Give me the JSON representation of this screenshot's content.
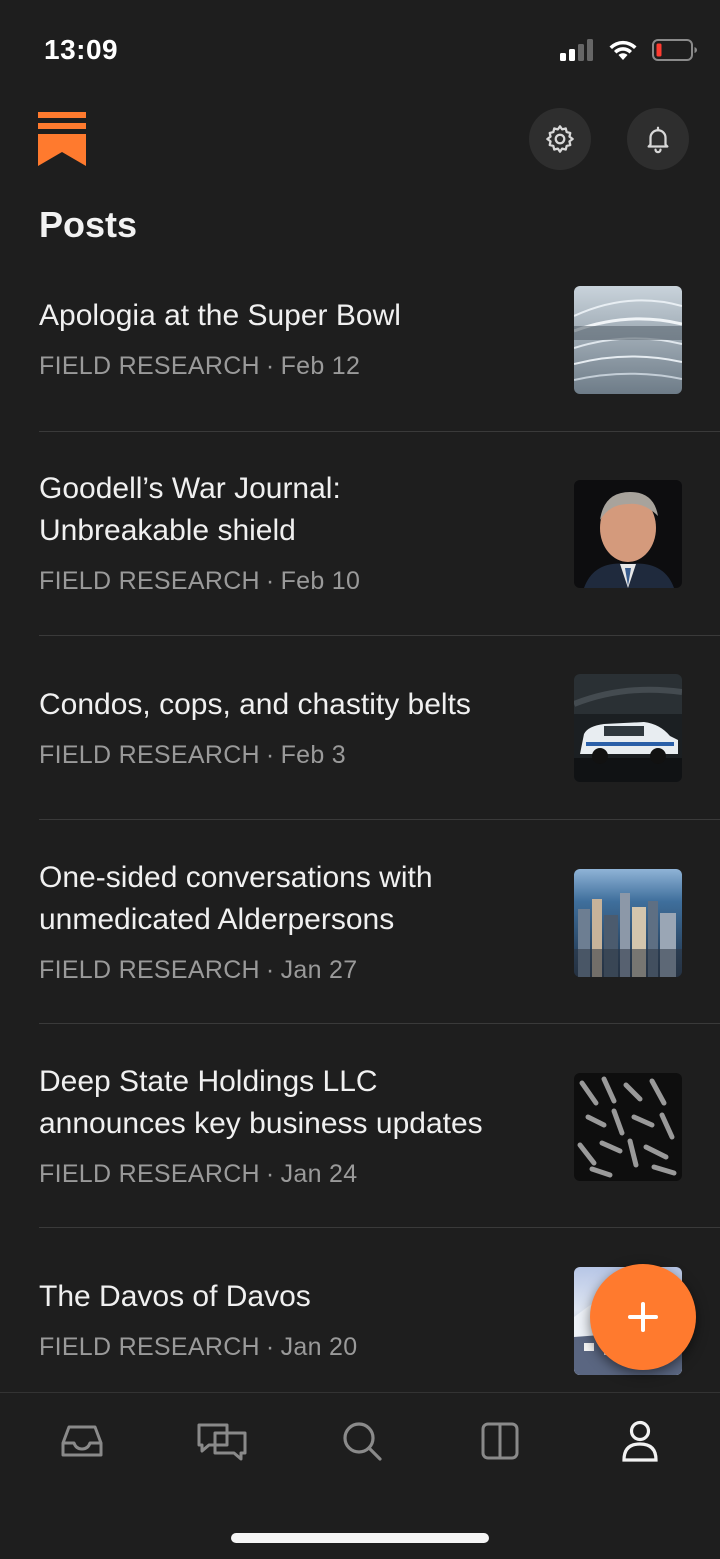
{
  "status_bar": {
    "time": "13:09"
  },
  "header": {
    "title": "Posts"
  },
  "posts": [
    {
      "title_lines": [
        "Apologia at the Super Bowl"
      ],
      "section": "FIELD RESEARCH",
      "date": "Feb 12",
      "thumb": "stadium-image"
    },
    {
      "title_lines": [
        "Goodell’s War Journal:",
        "Unbreakable shield"
      ],
      "section": "FIELD RESEARCH",
      "date": "Feb 10",
      "thumb": "portrait-image"
    },
    {
      "title_lines": [
        "Condos, cops, and chastity belts"
      ],
      "section": "FIELD RESEARCH",
      "date": "Feb 3",
      "thumb": "police-car-image"
    },
    {
      "title_lines": [
        "One-sided conversations with",
        "unmedicated Alderpersons"
      ],
      "section": "FIELD RESEARCH",
      "date": "Jan 27",
      "thumb": "city-skyline-image"
    },
    {
      "title_lines": [
        "Deep State Holdings LLC",
        "announces key business updates"
      ],
      "section": "FIELD RESEARCH",
      "date": "Jan 24",
      "thumb": "bullets-image"
    },
    {
      "title_lines": [
        "The Davos of Davos"
      ],
      "section": "FIELD RESEARCH",
      "date": "Jan 20",
      "thumb": "snowy-town-image"
    }
  ],
  "meta_separator": "·",
  "colors": {
    "accent": "#ff7a2e",
    "background": "#1e1e1e",
    "meta": "#9a9a9a"
  },
  "tabs": [
    {
      "name": "inbox",
      "icon": "inbox-icon"
    },
    {
      "name": "chats",
      "icon": "chat-bubbles-icon"
    },
    {
      "name": "search",
      "icon": "search-icon"
    },
    {
      "name": "reader",
      "icon": "split-view-icon"
    },
    {
      "name": "profile",
      "icon": "person-icon",
      "active": true
    }
  ]
}
